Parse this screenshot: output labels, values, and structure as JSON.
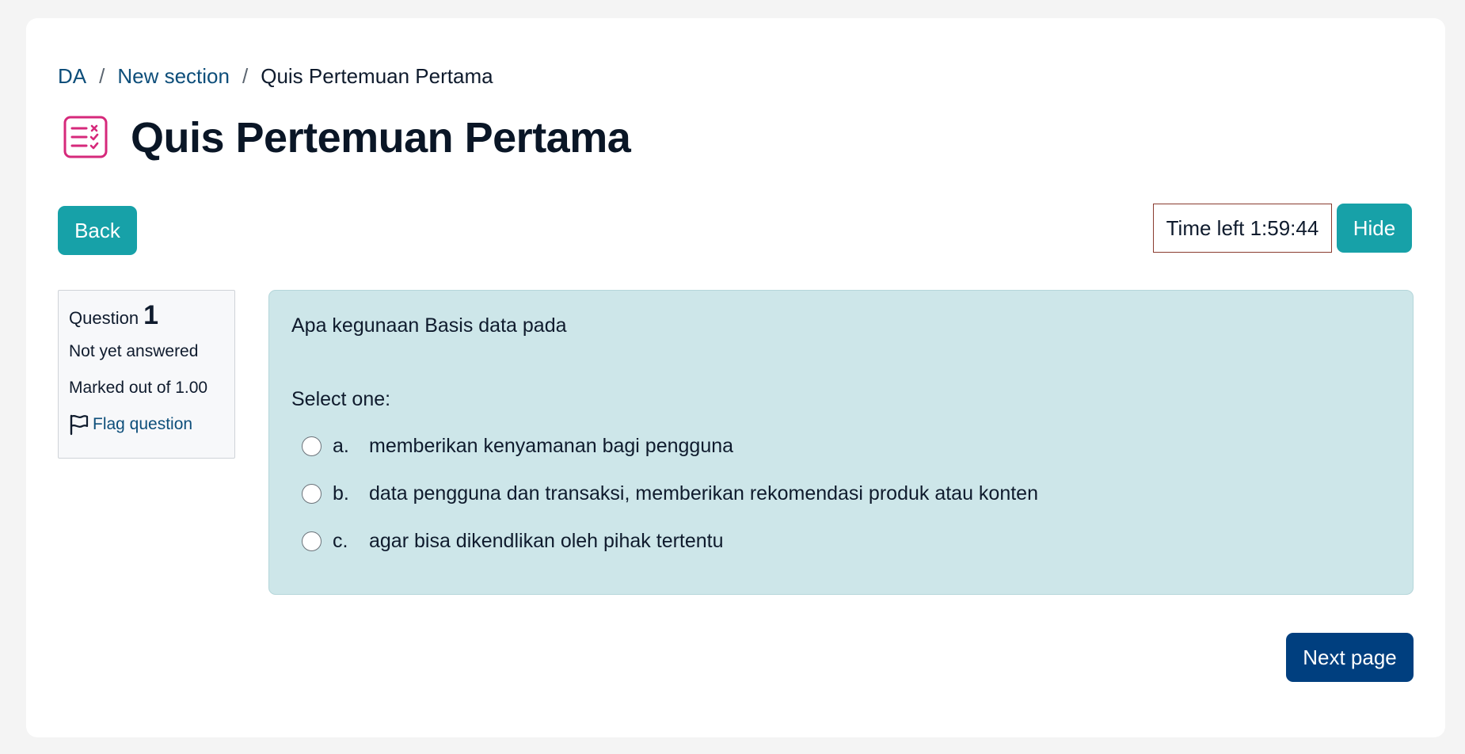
{
  "breadcrumb": {
    "items": [
      "DA",
      "New section"
    ],
    "separator": "/",
    "current": "Quis Pertemuan Pertama"
  },
  "page": {
    "title": "Quis Pertemuan Pertama",
    "icon": "quiz-checklist-icon"
  },
  "toolbar": {
    "back_label": "Back",
    "timer_label": "Time left 1:59:44",
    "hide_label": "Hide"
  },
  "question_info": {
    "label": "Question",
    "number": "1",
    "state": "Not yet answered",
    "mark": "Marked out of 1.00",
    "flag_label": "Flag question"
  },
  "question": {
    "text": "Apa kegunaan Basis data pada",
    "prompt": "Select one:",
    "answers": [
      {
        "letter": "a.",
        "text": "memberikan kenyamanan bagi pengguna"
      },
      {
        "letter": "b.",
        "text": "data pengguna dan transaksi, memberikan rekomendasi produk atau konten"
      },
      {
        "letter": "c.",
        "text": "agar bisa dikendlikan oleh pihak tertentu"
      }
    ]
  },
  "navigation": {
    "next_label": "Next page"
  },
  "colors": {
    "accent_teal": "#17a1a8",
    "primary_blue": "#003f7f",
    "link": "#0d4e7a",
    "question_bg": "#cde6e9",
    "icon_pink": "#d6297b"
  }
}
